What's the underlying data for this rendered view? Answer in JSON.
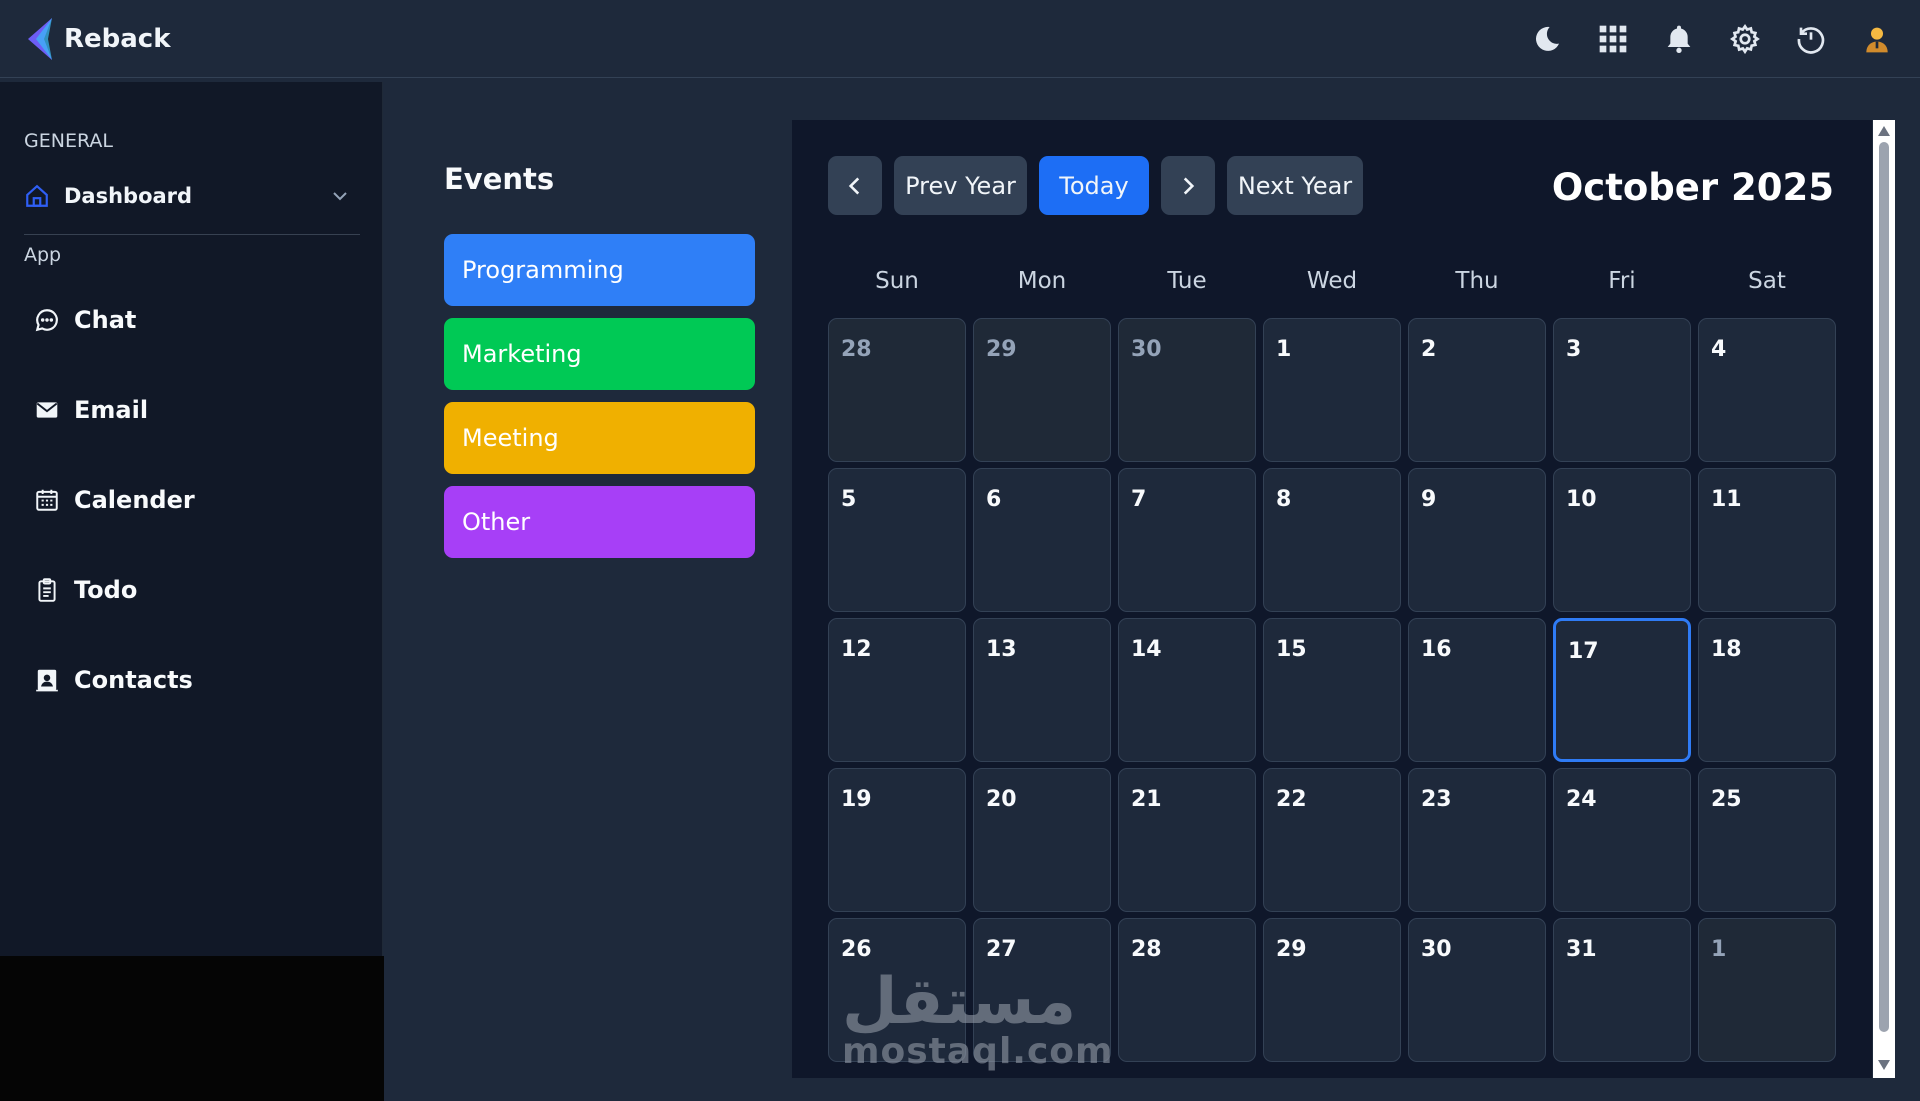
{
  "app": {
    "name": "Reback"
  },
  "header": {
    "icons": [
      "moon-icon",
      "apps-grid-icon",
      "bell-icon",
      "gear-icon",
      "history-icon",
      "user-avatar-icon"
    ]
  },
  "sidebar": {
    "general_label": "GENERAL",
    "dashboard": {
      "label": "Dashboard",
      "icon": "home-icon"
    },
    "app_label": "App",
    "items": [
      {
        "label": "Chat",
        "icon": "chat-icon"
      },
      {
        "label": "Email",
        "icon": "mail-icon"
      },
      {
        "label": "Calender",
        "icon": "calendar-icon"
      },
      {
        "label": "Todo",
        "icon": "clipboard-icon"
      },
      {
        "label": "Contacts",
        "icon": "contacts-icon"
      }
    ]
  },
  "events": {
    "title": "Events",
    "items": [
      {
        "label": "Programming",
        "color": "#2f7ff7"
      },
      {
        "label": "Marketing",
        "color": "#00c955"
      },
      {
        "label": "Meeting",
        "color": "#f0b000"
      },
      {
        "label": "Other",
        "color": "#a73ff7"
      }
    ]
  },
  "calendar": {
    "prev_label": "Prev Year",
    "today_label": "Today",
    "next_label": "Next Year",
    "month_title": "October 2025",
    "weekdays": [
      "Sun",
      "Mon",
      "Tue",
      "Wed",
      "Thu",
      "Fri",
      "Sat"
    ],
    "today": "17",
    "weeks": [
      [
        {
          "d": "28",
          "m": true
        },
        {
          "d": "29",
          "m": true
        },
        {
          "d": "30",
          "m": true
        },
        {
          "d": "1"
        },
        {
          "d": "2"
        },
        {
          "d": "3"
        },
        {
          "d": "4"
        }
      ],
      [
        {
          "d": "5"
        },
        {
          "d": "6"
        },
        {
          "d": "7"
        },
        {
          "d": "8"
        },
        {
          "d": "9"
        },
        {
          "d": "10"
        },
        {
          "d": "11"
        }
      ],
      [
        {
          "d": "12"
        },
        {
          "d": "13"
        },
        {
          "d": "14"
        },
        {
          "d": "15"
        },
        {
          "d": "16"
        },
        {
          "d": "17"
        },
        {
          "d": "18"
        }
      ],
      [
        {
          "d": "19"
        },
        {
          "d": "20"
        },
        {
          "d": "21"
        },
        {
          "d": "22"
        },
        {
          "d": "23"
        },
        {
          "d": "24"
        },
        {
          "d": "25"
        }
      ],
      [
        {
          "d": "26"
        },
        {
          "d": "27"
        },
        {
          "d": "28"
        },
        {
          "d": "29"
        },
        {
          "d": "30"
        },
        {
          "d": "31"
        },
        {
          "d": "1",
          "m": true
        }
      ]
    ]
  },
  "watermark": {
    "arabic": "مستقل",
    "latin": "mostaql.com"
  }
}
